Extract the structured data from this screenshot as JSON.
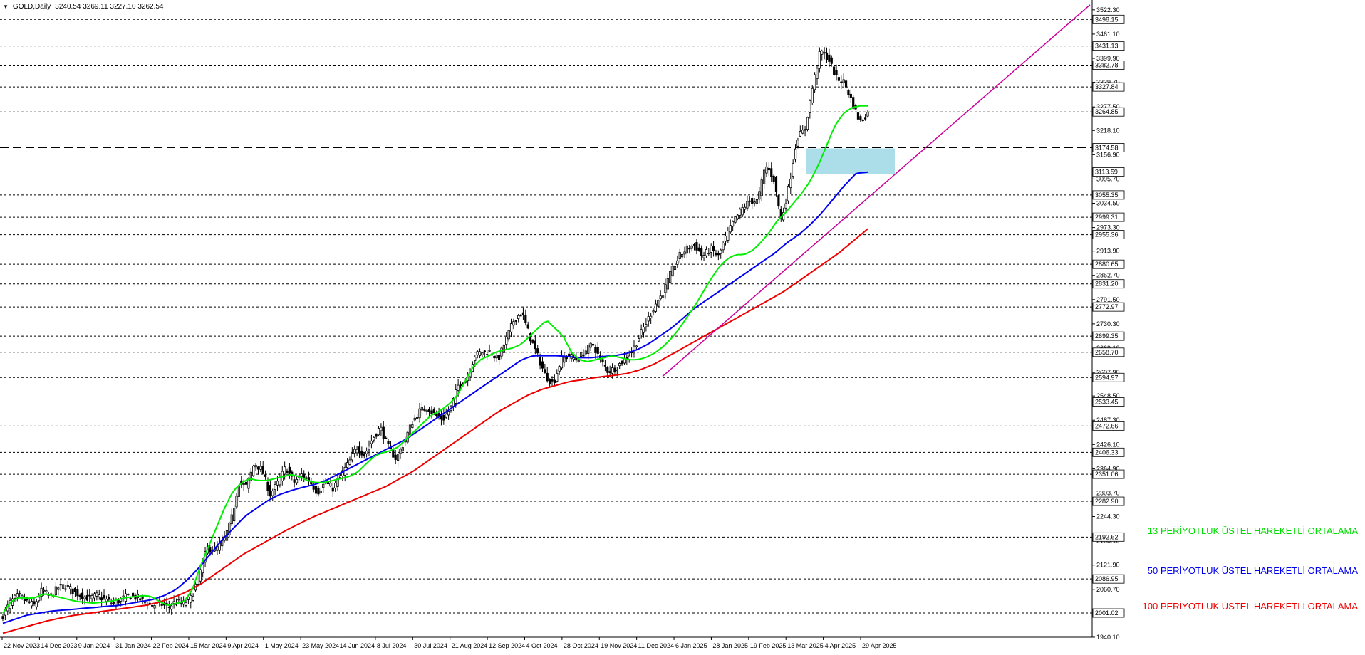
{
  "header": {
    "symbol": "GOLD,Daily",
    "ohlc": "3240.54 3269.11 3227.10 3262.54"
  },
  "legend": {
    "ema13": "13 PERİYOTLUK ÜSTEL HAREKETLİ ORTALAMA",
    "ema50": "50 PERİYOTLUK ÜSTEL HAREKETLİ ORTALAMA",
    "ema100": "100 PERİYOTLUK ÜSTEL HAREKETLİ ORTALAMA"
  },
  "colors": {
    "candle": "#000000",
    "ema13": "#00ee00",
    "ema50": "#0000ee",
    "ema100": "#ee0000",
    "trendline": "#cc0099",
    "zone": "#8fd3e0",
    "grid": "#000000"
  },
  "chart_data": {
    "type": "candlestick",
    "price_scale_labels": [
      "3522.30",
      "3461.10",
      "3399.90",
      "3339.70",
      "3277.50",
      "3218.10",
      "3156.90",
      "3095.70",
      "3034.50",
      "2973.30",
      "2913.90",
      "2852.70",
      "2791.50",
      "2730.30",
      "2669.10",
      "2607.90",
      "2548.50",
      "2487.30",
      "2426.10",
      "2364.90",
      "2303.70",
      "2244.30",
      "2183.10",
      "2121.90",
      "2060.70",
      "1940.10"
    ],
    "horizontal_levels": [
      "3498.15",
      "3431.13",
      "3382.78",
      "3327.84",
      "3264.85",
      "3174.58",
      "3113.59",
      "3055.35",
      "2999.31",
      "2955.36",
      "2880.65",
      "2831.20",
      "2772.97",
      "2699.35",
      "2658.70",
      "2594.97",
      "2533.45",
      "2472.66",
      "2406.33",
      "2351.06",
      "2282.90",
      "2192.62",
      "2086.95",
      "2001.02"
    ],
    "dashed_level": "3174.58",
    "x_tick_labels": [
      "22 Nov 2023",
      "14 Dec 2023",
      "9 Jan 2024",
      "31 Jan 2024",
      "22 Feb 2024",
      "15 Mar 2024",
      "9 Apr 2024",
      "1 May 2024",
      "23 May 2024",
      "14 Jun 2024",
      "8 Jul 2024",
      "30 Jul 2024",
      "21 Aug 2024",
      "12 Sep 2024",
      "4 Oct 2024",
      "28 Oct 2024",
      "19 Nov 2024",
      "11 Dec 2024",
      "6 Jan 2025",
      "28 Jan 2025",
      "19 Feb 2025",
      "13 Mar 2025",
      "4 Apr 2025",
      "29 Apr 2025"
    ],
    "close_path": [
      1995,
      2030,
      2045,
      2030,
      2020,
      2060,
      2040,
      2065,
      2070,
      2055,
      2045,
      2038,
      2045,
      2035,
      2025,
      2035,
      2045,
      2040,
      2030,
      2020,
      2025,
      2015,
      2030,
      2025,
      2040,
      2100,
      2165,
      2160,
      2180,
      2230,
      2330,
      2320,
      2380,
      2360,
      2300,
      2330,
      2370,
      2330,
      2350,
      2335,
      2305,
      2330,
      2315,
      2350,
      2380,
      2420,
      2400,
      2440,
      2470,
      2420,
      2390,
      2430,
      2480,
      2510,
      2520,
      2500,
      2490,
      2520,
      2580,
      2590,
      2650,
      2660,
      2660,
      2640,
      2690,
      2740,
      2760,
      2700,
      2650,
      2600,
      2580,
      2640,
      2650,
      2640,
      2660,
      2680,
      2640,
      2610,
      2620,
      2640,
      2660,
      2700,
      2740,
      2780,
      2810,
      2860,
      2900,
      2920,
      2930,
      2900,
      2920,
      2900,
      2950,
      2990,
      3020,
      3040,
      3040,
      3130,
      3100,
      2990,
      3080,
      3200,
      3220,
      3330,
      3420,
      3400,
      3350,
      3340,
      3290,
      3240,
      3262
    ],
    "ema13_path": [
      2000,
      2030,
      2040,
      2038,
      2040,
      2050,
      2045,
      2040,
      2035,
      2030,
      2028,
      2026,
      2028,
      2030,
      2035,
      2040,
      2042,
      2045,
      2043,
      2030,
      2020,
      2025,
      2030,
      2060,
      2120,
      2170,
      2220,
      2270,
      2310,
      2330,
      2340,
      2335,
      2335,
      2340,
      2345,
      2350,
      2345,
      2335,
      2330,
      2330,
      2335,
      2340,
      2345,
      2355,
      2375,
      2395,
      2405,
      2410,
      2420,
      2440,
      2460,
      2480,
      2500,
      2510,
      2525,
      2545,
      2580,
      2620,
      2640,
      2650,
      2660,
      2665,
      2670,
      2680,
      2700,
      2720,
      2740,
      2720,
      2700,
      2660,
      2640,
      2635,
      2640,
      2645,
      2650,
      2645,
      2640,
      2640,
      2645,
      2655,
      2670,
      2690,
      2715,
      2745,
      2775,
      2810,
      2845,
      2875,
      2895,
      2905,
      2905,
      2915,
      2935,
      2960,
      2990,
      3010,
      3035,
      3060,
      3090,
      3130,
      3180,
      3230,
      3260,
      3275,
      3280,
      3280
    ],
    "ema50_path": [
      1975,
      1985,
      1995,
      2000,
      2005,
      2008,
      2010,
      2013,
      2015,
      2018,
      2020,
      2025,
      2030,
      2035,
      2045,
      2060,
      2085,
      2115,
      2150,
      2185,
      2215,
      2245,
      2265,
      2285,
      2300,
      2310,
      2318,
      2325,
      2335,
      2350,
      2365,
      2380,
      2395,
      2410,
      2425,
      2440,
      2460,
      2480,
      2500,
      2520,
      2540,
      2560,
      2580,
      2600,
      2620,
      2640,
      2650,
      2650,
      2650,
      2648,
      2645,
      2645,
      2648,
      2650,
      2655,
      2665,
      2680,
      2700,
      2720,
      2745,
      2770,
      2790,
      2810,
      2830,
      2850,
      2870,
      2890,
      2910,
      2935,
      2955,
      2980,
      3010,
      3045,
      3080,
      3110,
      3113
    ],
    "ema100_path": [
      1950,
      1960,
      1970,
      1980,
      1988,
      1995,
      2000,
      2005,
      2010,
      2015,
      2020,
      2028,
      2040,
      2055,
      2075,
      2100,
      2125,
      2150,
      2170,
      2190,
      2210,
      2228,
      2245,
      2260,
      2275,
      2290,
      2305,
      2320,
      2340,
      2360,
      2385,
      2410,
      2435,
      2460,
      2485,
      2510,
      2530,
      2550,
      2565,
      2575,
      2585,
      2590,
      2596,
      2600,
      2605,
      2615,
      2630,
      2650,
      2670,
      2690,
      2710,
      2730,
      2750,
      2770,
      2790,
      2810,
      2835,
      2860,
      2885,
      2910,
      2940,
      2970
    ],
    "ylim": [
      1940,
      3540
    ]
  }
}
